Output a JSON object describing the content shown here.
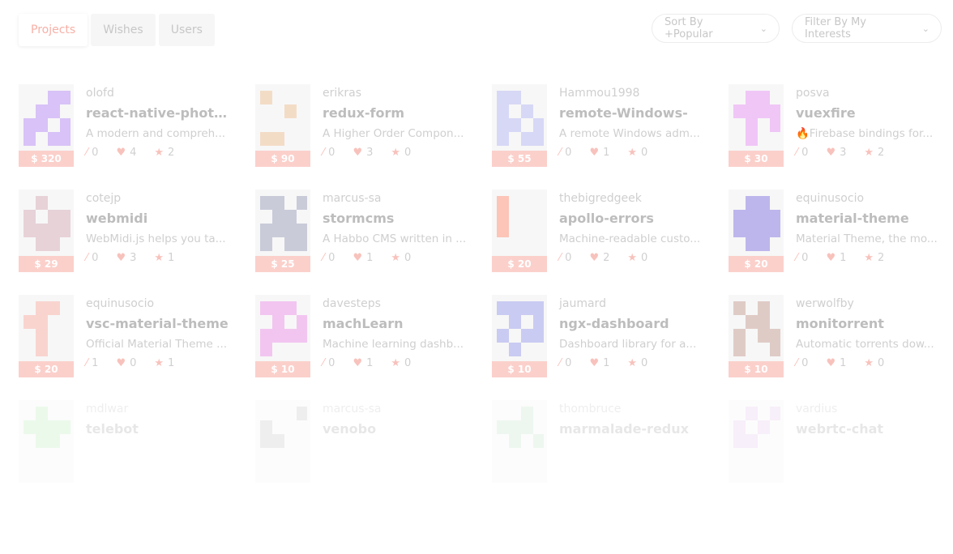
{
  "tabs": [
    {
      "label": "Projects",
      "active": true
    },
    {
      "label": "Wishes",
      "active": false
    },
    {
      "label": "Users",
      "active": false
    }
  ],
  "sort": {
    "label": "Sort By +Popular"
  },
  "filter": {
    "label": "Filter By My Interests"
  },
  "colors": {
    "accent": "#f7b0a6",
    "price_bg": "#fbd0cb",
    "icon": "#f8c2bc"
  },
  "icons": {
    "contributions": "magic-wand-icon",
    "likes": "heart-icon",
    "stars": "star-icon",
    "dropdown": "chevron-down-icon"
  },
  "projects": [
    {
      "owner": "olofd",
      "name": "react-native-photos...",
      "desc": "A modern and compreh...",
      "price": "$ 320",
      "wand": "0",
      "heart": "4",
      "star": "2",
      "color": "#d8c2f7"
    },
    {
      "owner": "erikras",
      "name": "redux-form",
      "desc": "A Higher Order Compon...",
      "price": "$ 90",
      "wand": "0",
      "heart": "3",
      "star": "0",
      "color": "#f3dcc6"
    },
    {
      "owner": "Hammou1998",
      "name": "remote-Windows-",
      "desc": "A remote Windows adm...",
      "price": "$ 55",
      "wand": "0",
      "heart": "1",
      "star": "0",
      "color": "#d7d8f6"
    },
    {
      "owner": "posva",
      "name": "vuexfire",
      "desc": "🔥Firebase bindings for...",
      "price": "$ 30",
      "wand": "0",
      "heart": "3",
      "star": "2",
      "color": "#efc6f6"
    },
    {
      "owner": "cotejp",
      "name": "webmidi",
      "desc": "WebMidi.js helps you ta...",
      "price": "$ 29",
      "wand": "0",
      "heart": "3",
      "star": "1",
      "color": "#e7d2d8"
    },
    {
      "owner": "marcus-sa",
      "name": "stormcms",
      "desc": "A Habbo CMS written in ...",
      "price": "$ 25",
      "wand": "0",
      "heart": "1",
      "star": "0",
      "color": "#c9cbd9"
    },
    {
      "owner": "thebigredgeek",
      "name": "apollo-errors",
      "desc": "Machine-readable custo...",
      "price": "$ 20",
      "wand": "0",
      "heart": "2",
      "star": "0",
      "color": "#fcc5b8"
    },
    {
      "owner": "equinusocio",
      "name": "material-theme",
      "desc": "Material Theme, the mo...",
      "price": "$ 20",
      "wand": "0",
      "heart": "1",
      "star": "2",
      "color": "#bdb6ec"
    },
    {
      "owner": "equinusocio",
      "name": "vsc-material-theme",
      "desc": "Official Material Theme ...",
      "price": "$ 20",
      "wand": "1",
      "heart": "0",
      "star": "1",
      "color": "#f9d4cf"
    },
    {
      "owner": "davesteps",
      "name": "machLearn",
      "desc": "Machine learning dashb...",
      "price": "$ 10",
      "wand": "0",
      "heart": "1",
      "star": "0",
      "color": "#f2c5f0"
    },
    {
      "owner": "jaumard",
      "name": "ngx-dashboard",
      "desc": "Dashboard library for a...",
      "price": "$ 10",
      "wand": "0",
      "heart": "1",
      "star": "0",
      "color": "#c9cbf2"
    },
    {
      "owner": "werwolfby",
      "name": "monitorrent",
      "desc": "Automatic torrents dow...",
      "price": "$ 10",
      "wand": "0",
      "heart": "1",
      "star": "0",
      "color": "#dfcbc6"
    },
    {
      "owner": "mdlwar",
      "name": "telebot",
      "desc": "",
      "price": "",
      "wand": "",
      "heart": "",
      "star": "",
      "color": "#c8eec6"
    },
    {
      "owner": "marcus-sa",
      "name": "venobo",
      "desc": "",
      "price": "",
      "wand": "",
      "heart": "",
      "star": "",
      "color": "#d0d0d0"
    },
    {
      "owner": "thombruce",
      "name": "marmalade-redux",
      "desc": "",
      "price": "",
      "wand": "",
      "heart": "",
      "star": "",
      "color": "#cfe6d6"
    },
    {
      "owner": "vardius",
      "name": "webrtc-chat",
      "desc": "",
      "price": "",
      "wand": "",
      "heart": "",
      "star": "",
      "color": "#ead2f2"
    }
  ]
}
